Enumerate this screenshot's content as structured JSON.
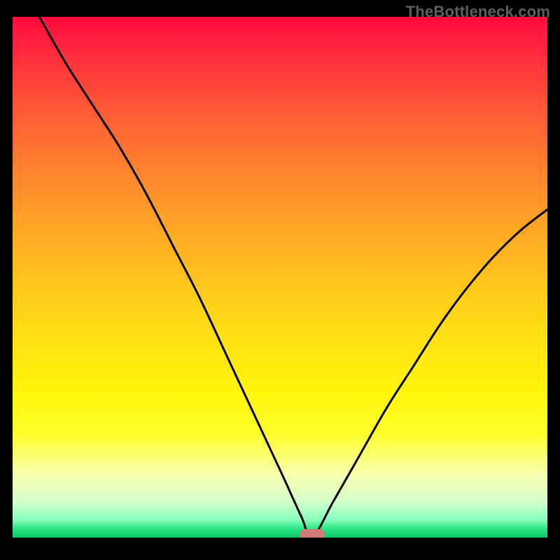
{
  "watermark": "TheBottleneck.com",
  "chart_data": {
    "type": "line",
    "title": "",
    "xlabel": "",
    "ylabel": "",
    "xlim": [
      0,
      100
    ],
    "ylim": [
      0,
      100
    ],
    "grid": false,
    "series": [
      {
        "name": "curve",
        "x": [
          5,
          10,
          15,
          20,
          25,
          30,
          35,
          40,
          45,
          50,
          54,
          56,
          60,
          65,
          70,
          75,
          80,
          85,
          90,
          95,
          100
        ],
        "values": [
          100,
          91,
          83,
          75,
          66,
          56,
          46,
          35,
          24,
          13,
          4,
          0,
          7,
          16,
          25,
          33,
          41,
          48,
          54,
          59,
          63
        ]
      }
    ],
    "marker": {
      "x": 56,
      "y": 0
    },
    "gradient_stops": [
      {
        "pos": 0,
        "color": "#ff0a3e"
      },
      {
        "pos": 0.5,
        "color": "#ffe213"
      },
      {
        "pos": 0.88,
        "color": "#f8ffb0"
      },
      {
        "pos": 1.0,
        "color": "#0cc96a"
      }
    ]
  }
}
